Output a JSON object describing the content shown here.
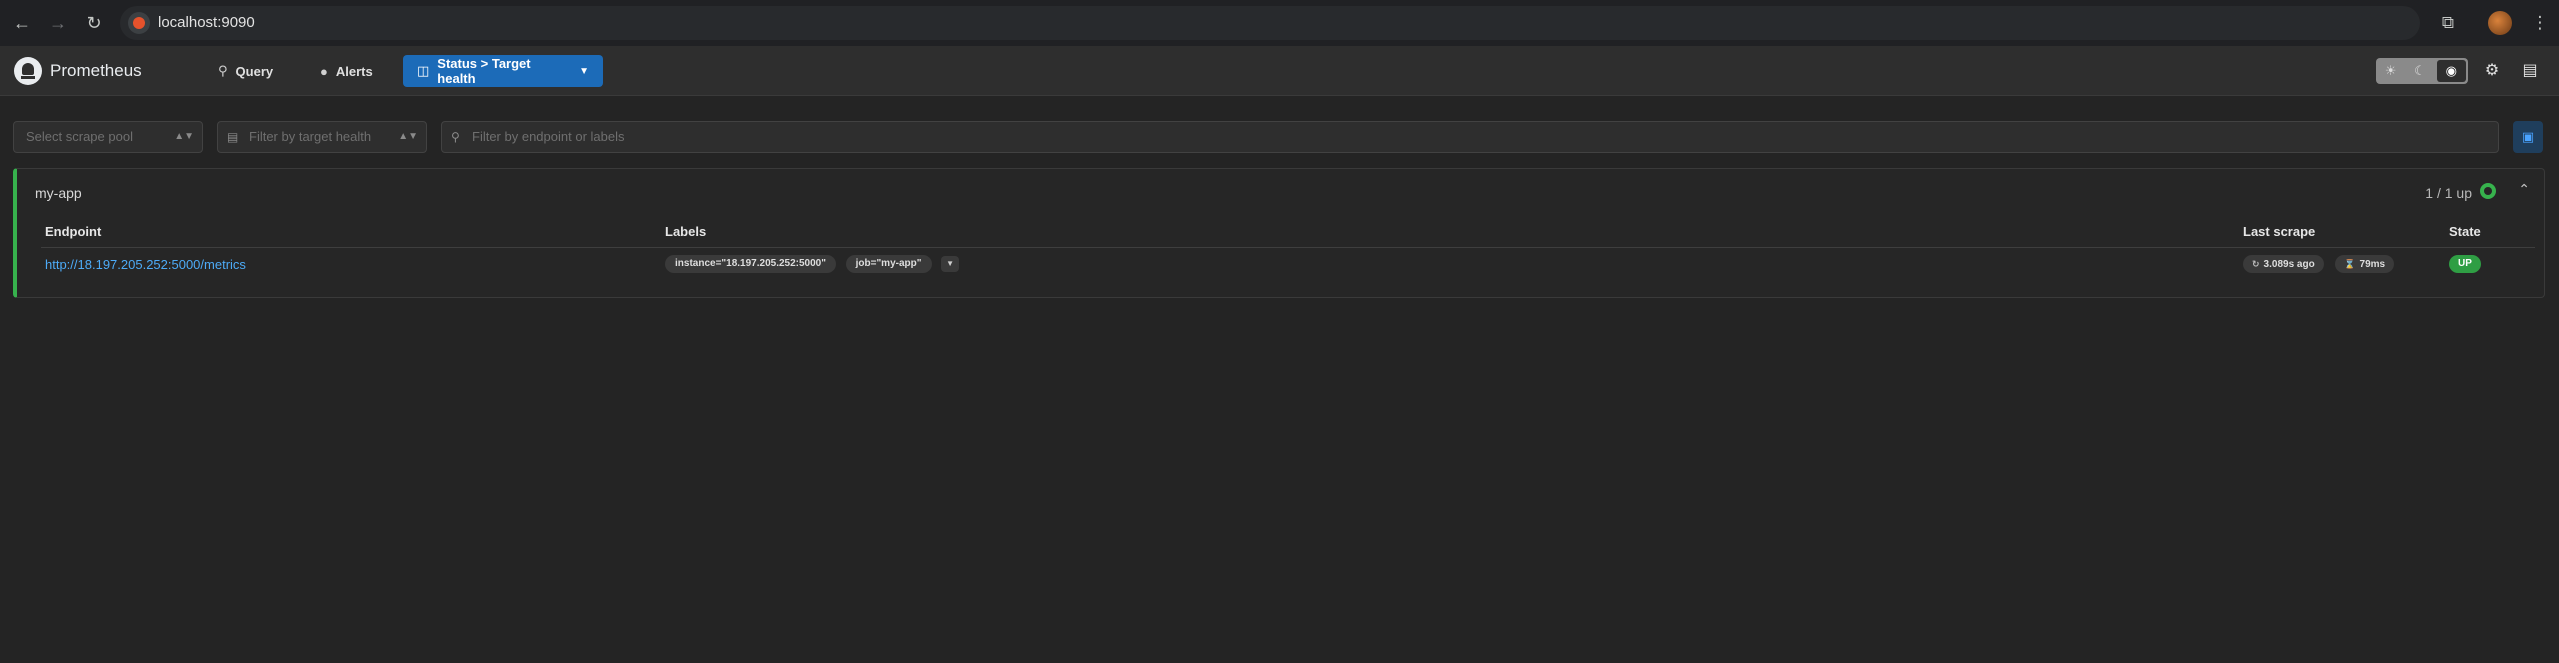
{
  "browser": {
    "url": "localhost:9090",
    "back_icon": "arrow-left-icon",
    "forward_icon": "arrow-right-icon",
    "reload_icon": "reload-icon"
  },
  "header": {
    "brand": "Prometheus",
    "nav": [
      {
        "label": "Query",
        "icon": "search-icon"
      },
      {
        "label": "Alerts",
        "icon": "bell-icon"
      },
      {
        "label": "Status > Target health",
        "icon": "monitor-icon",
        "active": true
      }
    ],
    "accent_color": "#1c6bb8"
  },
  "filters": {
    "scrape_pool_placeholder": "Select scrape pool",
    "health_placeholder": "Filter by target health",
    "search_placeholder": "Filter by endpoint or labels"
  },
  "pool": {
    "name": "my-app",
    "up_count": "1 / 1 up",
    "status_color": "#37b24d",
    "columns": {
      "endpoint": "Endpoint",
      "labels": "Labels",
      "last_scrape": "Last scrape",
      "state": "State"
    },
    "targets": [
      {
        "endpoint": "http://18.197.205.252:5000/metrics",
        "labels": [
          "instance=\"18.197.205.252:5000\"",
          "job=\"my-app\""
        ],
        "last_scrape": "3.089s ago",
        "scrape_duration": "79ms",
        "state": "UP"
      }
    ]
  }
}
